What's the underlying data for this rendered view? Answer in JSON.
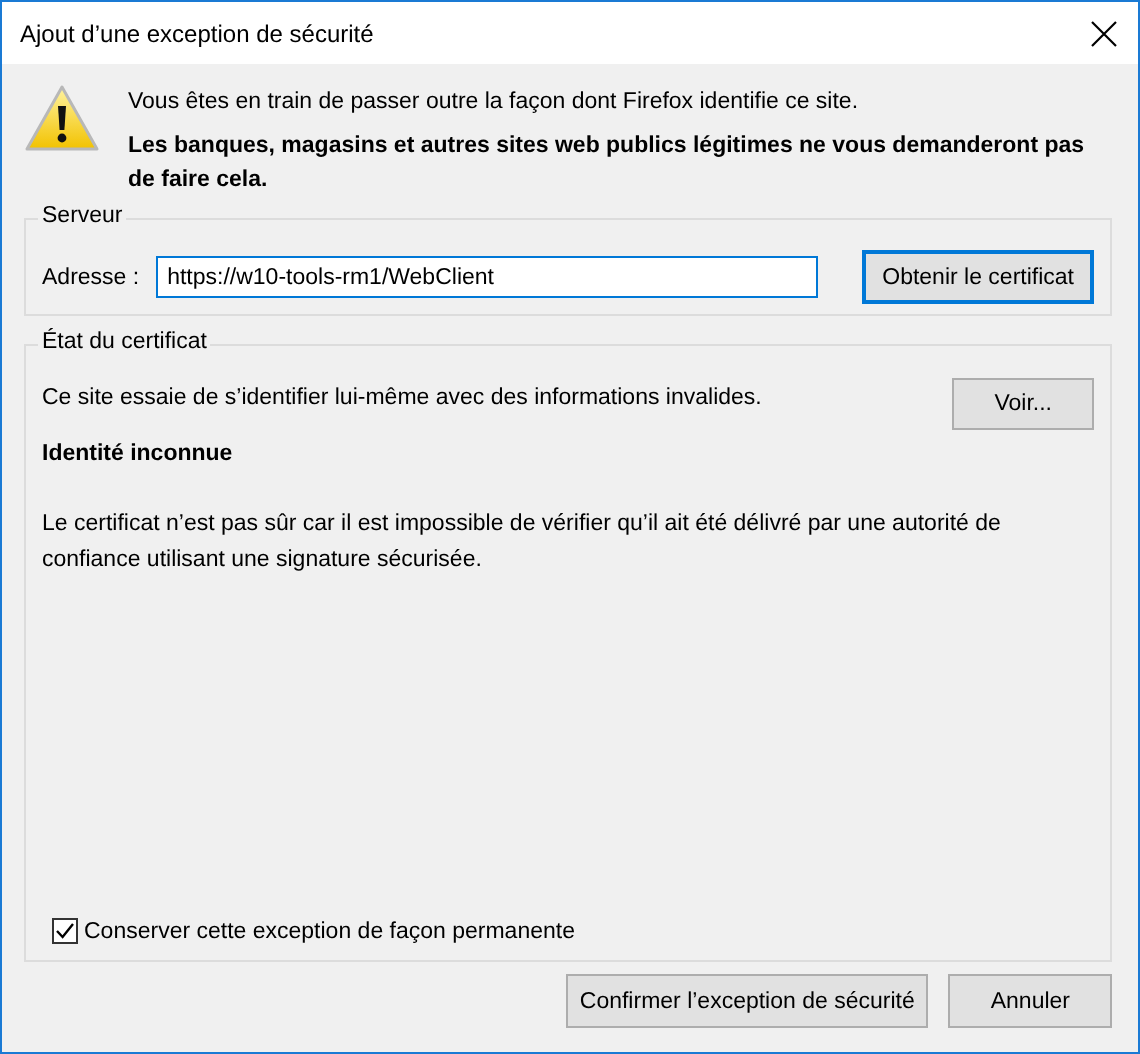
{
  "window": {
    "title": "Ajout d’une exception de sécurité"
  },
  "warning": {
    "message": "Vous êtes en train de passer outre la façon dont Firefox identifie ce site.",
    "note": "Les banques, magasins et autres sites web publics légitimes ne vous demanderont pas de faire cela."
  },
  "server": {
    "legend": "Serveur",
    "address_label": "Adresse :",
    "address_value": "https://w10-tools-rm1/WebClient",
    "fetch_button": "Obtenir le certificat"
  },
  "certificate_status": {
    "legend": "État du certificat",
    "summary": "Ce site essaie de s’identifier lui-même avec des informations invalides.",
    "view_button": "Voir...",
    "heading": "Identité inconnue",
    "details": "Le certificat n’est pas sûr car il est impossible de vérifier qu’il ait été délivré par une autorité de confiance utilisant une signature sécurisée."
  },
  "permanent": {
    "label": "Conserver cette exception de façon permanente",
    "checked": true
  },
  "buttons": [
    {
      "label": "Confirmer l’exception de sécurité"
    },
    {
      "label": "Annuler"
    }
  ]
}
